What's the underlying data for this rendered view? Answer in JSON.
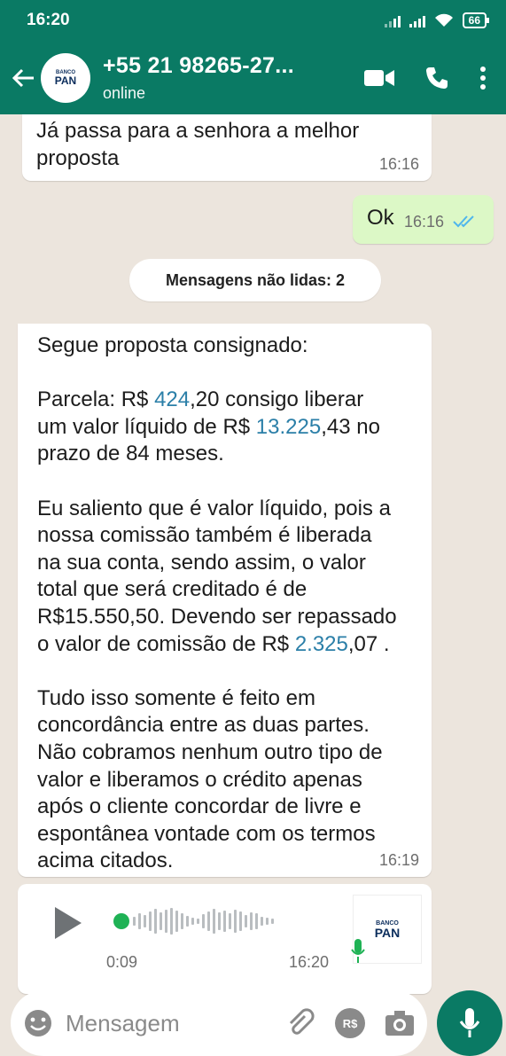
{
  "status_bar": {
    "time": "16:20",
    "battery": "66"
  },
  "header": {
    "contact_name": "+55 21 98265-27...",
    "status": "online",
    "avatar_text_small": "BANCO",
    "avatar_text": "PAN"
  },
  "chat": {
    "messages": [
      {
        "direction": "in",
        "text": "Já passa para a senhora a melhor\nproposta",
        "time": "16:16"
      },
      {
        "direction": "out",
        "text": "Ok",
        "time": "16:16"
      }
    ],
    "unread_label": "Mensagens não lidas: 2",
    "proposal": {
      "line1": "Segue proposta consignado:",
      "p2_a": "Parcela: R$ ",
      "p2_b": "424",
      "p2_c": ",20 consigo liberar\num valor líquido de R$ ",
      "p2_d": "13.225",
      "p2_e": ",43 no\nprazo de 84 meses.",
      "p3_a": "Eu saliento que é valor líquido, pois a\nnossa comissão também é liberada\nna sua conta, sendo assim, o valor\ntotal que será creditado é de\nR$15.550,50. Devendo ser repassado\no valor de comissão de R$ ",
      "p3_b": "2.325",
      "p3_c": ",07 .",
      "p4": "Tudo isso somente é feito em\nconcordância entre as duas partes.\nNão cobramos nenhum outro tipo de\nvalor e liberamos o crédito apenas\napós o cliente concordar de livre e\nespontânea vontade com os termos\nacima citados.",
      "time": "16:19"
    },
    "voice_note": {
      "duration": "0:09",
      "time": "16:20",
      "progress": 0.0,
      "thumb_small": "BANCO",
      "thumb_text": "PAN"
    }
  },
  "composer": {
    "placeholder": "Mensagem",
    "currency_icon_text": "R$"
  },
  "colors": {
    "header": "#0a7a64",
    "link": "#2b7fa8",
    "outgoing": "#dcf8c6",
    "read_ticks": "#4fb6ec"
  }
}
